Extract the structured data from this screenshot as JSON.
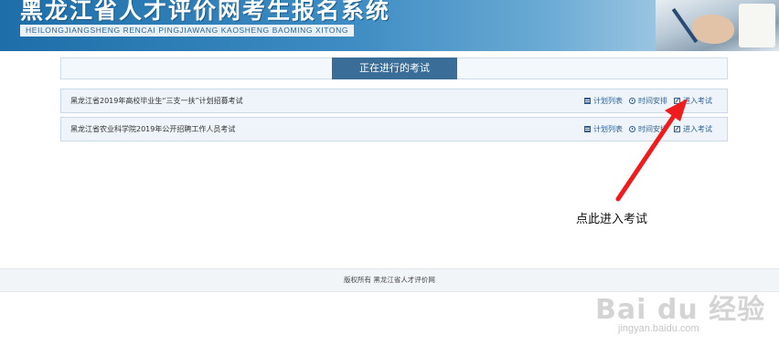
{
  "header": {
    "title": "黑龙江省人才评价网考生报名系统",
    "subtitle": "HEILONGJIANGSHENG RENCAI PINGJIAWANG KAOSHENG BAOMING XITONG"
  },
  "tabs": {
    "active_label": "正在进行的考试"
  },
  "exams": [
    {
      "name": "黑龙江省2019年高校毕业生“三支一扶”计划招募考试",
      "plan_list": "计划列表",
      "schedule": "时间安排",
      "enter": "进入考试"
    },
    {
      "name": "黑龙江省农业科学院2019年公开招聘工作人员考试",
      "plan_list": "计划列表",
      "schedule": "时间安排",
      "enter": "进入考试"
    }
  ],
  "annotation": {
    "text": "点此进入考试",
    "arrow_color": "#ee1c1c"
  },
  "footer": {
    "copyright": "版权所有 黑龙江省人才评价网"
  },
  "watermark": {
    "logo": "Bai du 经验",
    "url": "jingyan.baidu.com"
  },
  "colors": {
    "banner": "#2e7fb9",
    "tab_active": "#3a6e98",
    "link": "#2f5f93"
  }
}
